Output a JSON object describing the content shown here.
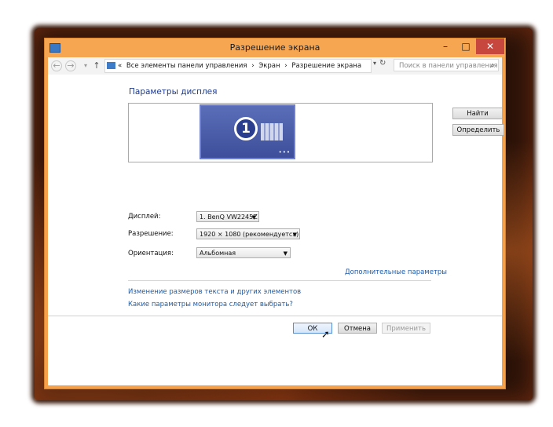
{
  "window": {
    "title": "Разрешение экрана",
    "controls": {
      "minimize": "–",
      "maximize": "□",
      "close": "✕"
    }
  },
  "address_bar": {
    "back": "←",
    "forward": "→",
    "dropdown": "▾",
    "up": "↑",
    "breadcrumbs": [
      "«",
      "Все элементы панели управления",
      "›",
      "Экран",
      "›",
      "Разрешение экрана"
    ],
    "refresh": "↻",
    "search_placeholder": "Поиск в панели управления",
    "search_icon": "⌕"
  },
  "main": {
    "heading": "Параметры дисплея",
    "monitor_number": "1",
    "monitor_dots": "•••",
    "find_button": "Найти",
    "identify_button": "Определить",
    "display_label": "Дисплей:",
    "display_value": "1. BenQ VW2245Z",
    "resolution_label": "Разрешение:",
    "resolution_value": "1920 × 1080 (рекомендуется)",
    "orientation_label": "Ориентация:",
    "orientation_value": "Альбомная",
    "advanced_link": "Дополнительные параметры",
    "text_size_link": "Изменение размеров текста и других элементов",
    "monitor_help_link": "Какие параметры монитора следует выбрать?",
    "ok_button": "ОК",
    "cancel_button": "Отмена",
    "apply_button": "Применить"
  },
  "colors": {
    "window_frame": "#f5a04a",
    "close_button": "#c7473f",
    "link": "#1e5ba8",
    "heading": "#1e3a8c"
  }
}
